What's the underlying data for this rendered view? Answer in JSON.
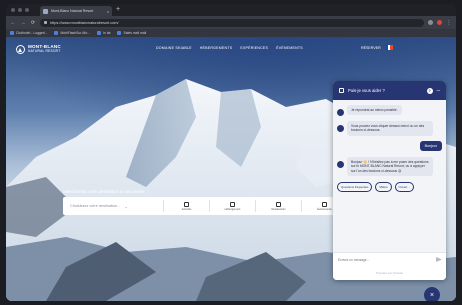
{
  "browser": {
    "tab_title": "Mont-Blanc Natural Resort",
    "tab_close": "×",
    "new_tab": "+",
    "url": "https://www.montblancnaturalresort.com/",
    "bookmarks": [
      "Clubhotel - Logged...",
      "MobiFlashSur-Mo...",
      "In lat",
      "Sales mail mail"
    ]
  },
  "site": {
    "logo_line1": "MONT-BLANC",
    "logo_line2": "NATURAL RESORT",
    "nav": [
      "DOMAINE SKIABLE",
      "HÉBERGEMENTS",
      "EXPÉRIENCES",
      "ÉVÉNEMENTS"
    ],
    "header_right": "RÉSERVER",
    "flag_colors": [
      "#0055a4",
      "#ffffff",
      "#ef4135"
    ]
  },
  "search": {
    "title": "Sélectionnez votre destination et vos envies",
    "destination_placeholder": "Choisissez votre destination...",
    "chevron": "⌄",
    "cells": [
      "Activités",
      "Hébergement",
      "Restaurants",
      "Événements"
    ]
  },
  "chat": {
    "header_title": "Puis-je vous aider ?",
    "help": "?",
    "minimize": "–",
    "bot_message_1": "Je répondrai au mieux possible.",
    "bot_message_2": "Vous pouvez vous cliquer dessus merci ou un des boutons ci-dessous.",
    "user_message": "Bonjour",
    "bot_message_3": "Bonjour 👋 ! N'hésitez pas à me poser des questions sur le MONT-BLANC Natural Resort, ou à appuyer sur l'un des boutons ci-dessous 😊",
    "quick_replies": [
      "Questions fréquentes",
      "Météo",
      "Ouvert..."
    ],
    "input_placeholder": "Écrivez un message...",
    "footer": "Propulsé par Clustaar",
    "launcher_icon": "×"
  },
  "colors": {
    "chat_primary": "#273673",
    "sky": "#2f4f84"
  }
}
